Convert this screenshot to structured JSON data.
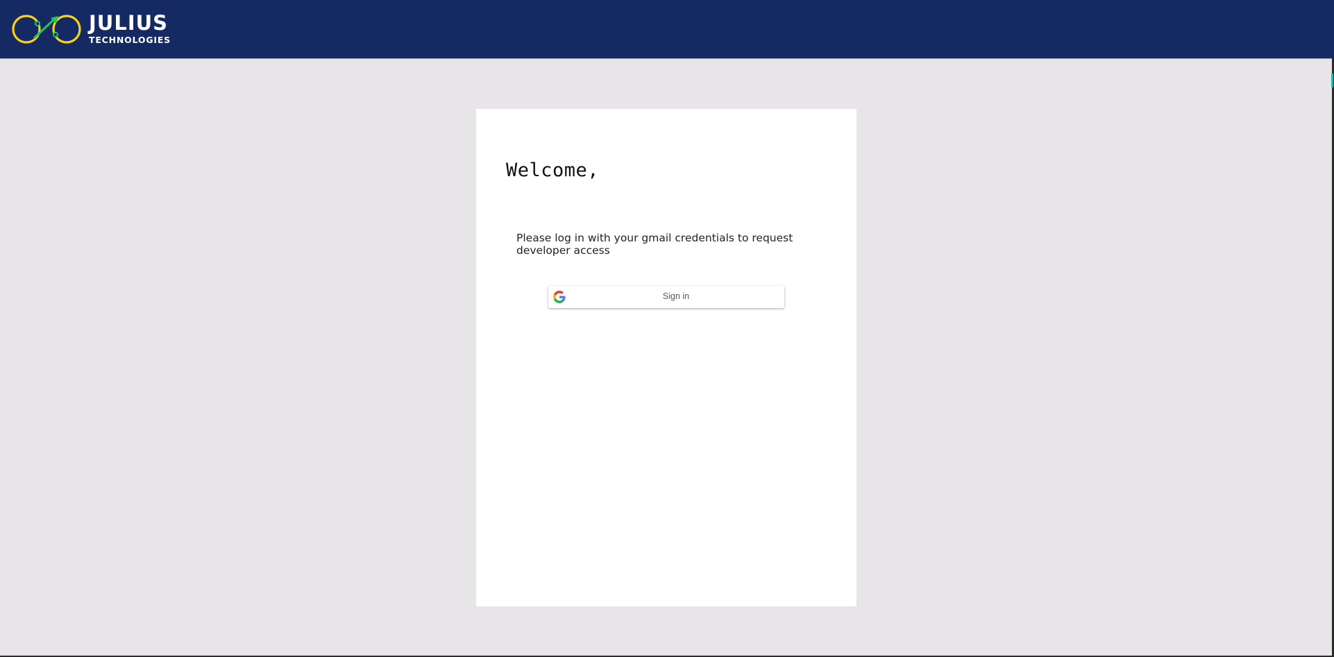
{
  "header": {
    "brand_title": "JULIUS",
    "brand_subtitle": "TECHNOLOGIES",
    "background_color": "#152a62",
    "logo_ring_color": "#f4d21f",
    "logo_arrow_color": "#22c55e"
  },
  "main": {
    "welcome_heading": "Welcome,",
    "instructions": "Please log in with your gmail credentials to request developer access",
    "sign_in_button": {
      "label": "Sign in",
      "icon": "google-icon"
    }
  },
  "colors": {
    "page_background": "#e7e5e8",
    "card_background": "#ffffff"
  }
}
